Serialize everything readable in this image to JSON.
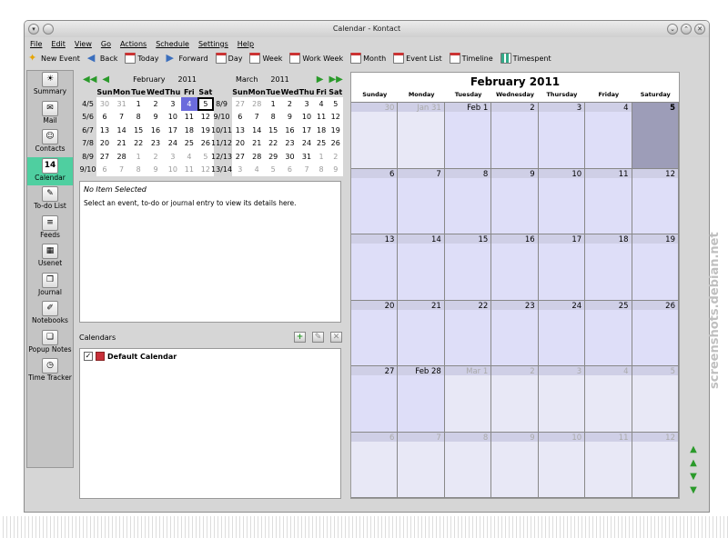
{
  "window": {
    "title": "Calendar - Kontact"
  },
  "menu": [
    "File",
    "Edit",
    "View",
    "Go",
    "Actions",
    "Schedule",
    "Settings",
    "Help"
  ],
  "toolbar": [
    {
      "label": "New Event",
      "icon": "new-event-icon"
    },
    {
      "label": "Back",
      "icon": "back-arrow-icon"
    },
    {
      "label": "Today",
      "icon": "today-icon"
    },
    {
      "label": "Forward",
      "icon": "forward-arrow-icon"
    },
    {
      "label": "Day",
      "icon": "day-view-icon"
    },
    {
      "label": "Week",
      "icon": "week-view-icon"
    },
    {
      "label": "Work Week",
      "icon": "work-week-icon"
    },
    {
      "label": "Month",
      "icon": "month-view-icon"
    },
    {
      "label": "Event List",
      "icon": "event-list-icon"
    },
    {
      "label": "Timeline",
      "icon": "timeline-icon"
    },
    {
      "label": "Timespent",
      "icon": "timespent-icon"
    }
  ],
  "sidebar": [
    {
      "label": "Summary",
      "glyph": "☀"
    },
    {
      "label": "Mail",
      "glyph": "✉"
    },
    {
      "label": "Contacts",
      "glyph": "☺"
    },
    {
      "label": "Calendar",
      "glyph": "14",
      "active": true
    },
    {
      "label": "To-do List",
      "glyph": "✎"
    },
    {
      "label": "Feeds",
      "glyph": "≡"
    },
    {
      "label": "Usenet",
      "glyph": "▦"
    },
    {
      "label": "Journal",
      "glyph": "❐"
    },
    {
      "label": "Notebooks",
      "glyph": "✐"
    },
    {
      "label": "Popup Notes",
      "glyph": "❏"
    },
    {
      "label": "Time Tracker",
      "glyph": "◷"
    }
  ],
  "mini1": {
    "month": "February",
    "year": "2011",
    "days": [
      "Sun",
      "Mon",
      "Tue",
      "Wed",
      "Thu",
      "Fri",
      "Sat"
    ],
    "weeks": [
      "4/5",
      "5/6",
      "6/7",
      "7/8",
      "8/9",
      "9/10"
    ],
    "rows": [
      [
        "30",
        "31",
        "1",
        "2",
        "3",
        "4",
        "5"
      ],
      [
        "6",
        "7",
        "8",
        "9",
        "10",
        "11",
        "12"
      ],
      [
        "13",
        "14",
        "15",
        "16",
        "17",
        "18",
        "19"
      ],
      [
        "20",
        "21",
        "22",
        "23",
        "24",
        "25",
        "26"
      ],
      [
        "27",
        "28",
        "1",
        "2",
        "3",
        "4",
        "5"
      ],
      [
        "6",
        "7",
        "8",
        "9",
        "10",
        "11",
        "12"
      ]
    ]
  },
  "mini2": {
    "month": "March",
    "year": "2011",
    "days": [
      "Sun",
      "Mon",
      "Tue",
      "Wed",
      "Thu",
      "Fri",
      "Sat"
    ],
    "weeks": [
      "8/9",
      "9/10",
      "10/11",
      "11/12",
      "12/13",
      "13/14"
    ],
    "rows": [
      [
        "27",
        "28",
        "1",
        "2",
        "3",
        "4",
        "5"
      ],
      [
        "6",
        "7",
        "8",
        "9",
        "10",
        "11",
        "12"
      ],
      [
        "13",
        "14",
        "15",
        "16",
        "17",
        "18",
        "19"
      ],
      [
        "20",
        "21",
        "22",
        "23",
        "24",
        "25",
        "26"
      ],
      [
        "27",
        "28",
        "29",
        "30",
        "31",
        "1",
        "2"
      ],
      [
        "3",
        "4",
        "5",
        "6",
        "7",
        "8",
        "9"
      ]
    ]
  },
  "detail": {
    "title": "No Item Selected",
    "message": "Select an event, to-do or journal entry to view its details here."
  },
  "calendars": {
    "header": "Calendars",
    "items": [
      {
        "name": "Default Calendar",
        "checked": "✓",
        "color": "#c8303a"
      }
    ]
  },
  "month_view": {
    "title": "February 2011",
    "weekdays": [
      "Sunday",
      "Monday",
      "Tuesday",
      "Wednesday",
      "Thursday",
      "Friday",
      "Saturday"
    ],
    "cells": [
      [
        "30",
        "Jan 31",
        "Feb 1",
        "2",
        "3",
        "4",
        "5"
      ],
      [
        "6",
        "7",
        "8",
        "9",
        "10",
        "11",
        "12"
      ],
      [
        "13",
        "14",
        "15",
        "16",
        "17",
        "18",
        "19"
      ],
      [
        "20",
        "21",
        "22",
        "23",
        "24",
        "25",
        "26"
      ],
      [
        "27",
        "Feb 28",
        "Mar 1",
        "2",
        "3",
        "4",
        "5"
      ],
      [
        "6",
        "7",
        "8",
        "9",
        "10",
        "11",
        "12"
      ]
    ]
  },
  "watermark": "screenshots.debian.net"
}
